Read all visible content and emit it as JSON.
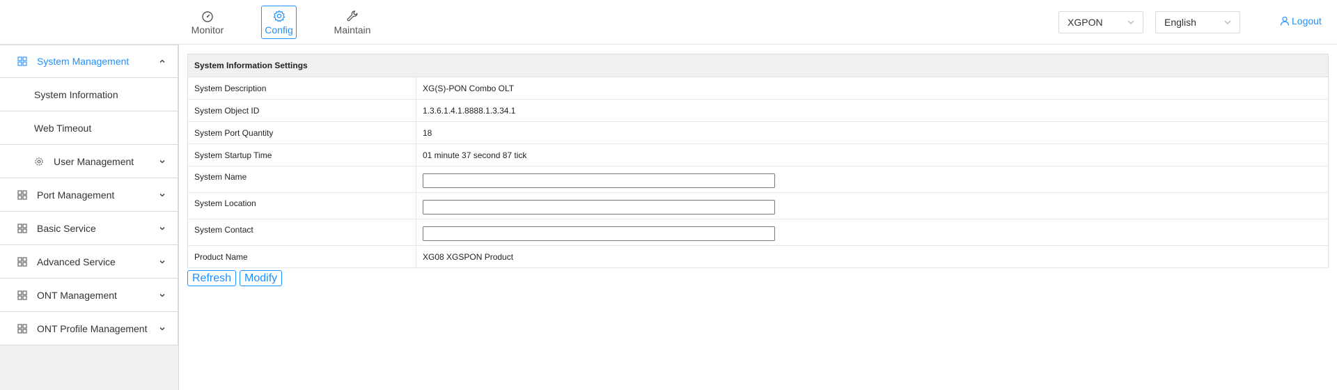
{
  "nav": {
    "tabs": [
      {
        "label": "Monitor",
        "icon": "dashboard-icon",
        "active": false
      },
      {
        "label": "Config",
        "icon": "gear-icon",
        "active": true
      },
      {
        "label": "Maintain",
        "icon": "wrench-icon",
        "active": false
      }
    ],
    "pon_select": {
      "value": "XGPON"
    },
    "language_select": {
      "value": "English"
    },
    "logout_label": "Logout"
  },
  "sidebar": {
    "items": [
      {
        "label": "System Management",
        "expanded": true
      },
      {
        "label": "System Information"
      },
      {
        "label": "Web Timeout"
      },
      {
        "label": "User Management"
      },
      {
        "label": "Port Management"
      },
      {
        "label": "Basic Service"
      },
      {
        "label": "Advanced Service"
      },
      {
        "label": "ONT Management"
      },
      {
        "label": "ONT Profile Management"
      }
    ]
  },
  "main": {
    "section_title": "System Information Settings",
    "rows": [
      {
        "label": "System Description",
        "value": "XG(S)-PON Combo OLT"
      },
      {
        "label": "System Object ID",
        "value": "1.3.6.1.4.1.8888.1.3.34.1"
      },
      {
        "label": "System Port Quantity",
        "value": "18"
      },
      {
        "label": "System Startup Time",
        "value": "01 minute 37 second 87 tick"
      },
      {
        "label": "System Name",
        "value": ""
      },
      {
        "label": "System Location",
        "value": ""
      },
      {
        "label": "System Contact",
        "value": ""
      },
      {
        "label": "Product Name",
        "value": "XG08 XGSPON Product"
      }
    ],
    "buttons": {
      "refresh": "Refresh",
      "modify": "Modify"
    }
  },
  "colors": {
    "accent": "#1e90ff"
  }
}
